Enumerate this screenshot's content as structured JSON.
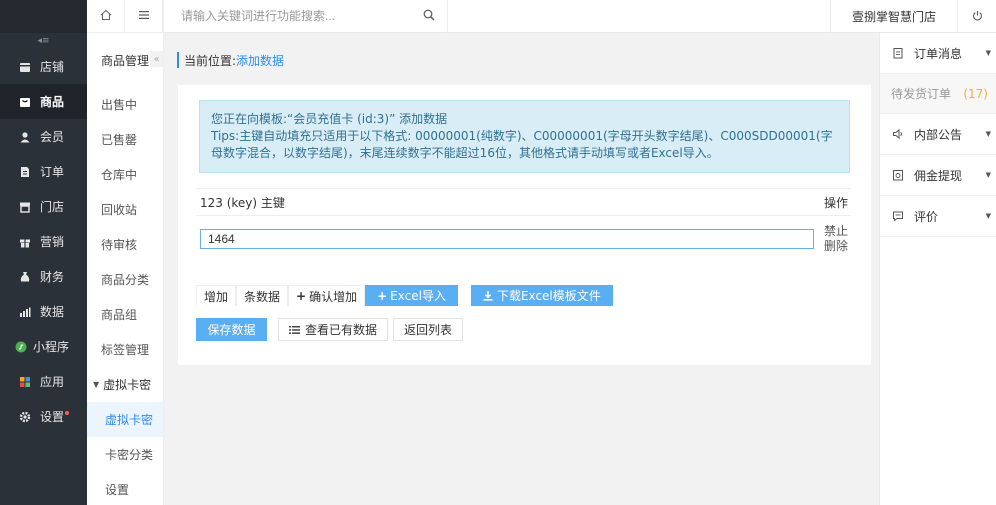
{
  "sidebar": {
    "collapse_glyph": "◂≡",
    "items": [
      {
        "label": "店铺",
        "icon": "store-icon"
      },
      {
        "label": "商品",
        "icon": "goods-icon",
        "active": true
      },
      {
        "label": "会员",
        "icon": "user-icon"
      },
      {
        "label": "订单",
        "icon": "order-icon"
      },
      {
        "label": "门店",
        "icon": "shop-icon"
      },
      {
        "label": "营销",
        "icon": "gift-icon"
      },
      {
        "label": "财务",
        "icon": "money-bag-icon"
      },
      {
        "label": "数据",
        "icon": "chart-icon"
      },
      {
        "label": "小程序",
        "icon": "miniapp-icon"
      },
      {
        "label": "应用",
        "icon": "apps-icon"
      },
      {
        "label": "设置",
        "icon": "gear-icon",
        "badge": true
      }
    ]
  },
  "subnav": {
    "title": "商品管理",
    "items": [
      "出售中",
      "已售罄",
      "仓库中",
      "回收站",
      "待审核",
      "商品分类",
      "商品组",
      "标签管理"
    ],
    "group": "虚拟卡密",
    "children": [
      "虚拟卡密",
      "卡密分类",
      "设置"
    ],
    "active_child": "虚拟卡密"
  },
  "topbar": {
    "search_placeholder": "请输入关键词进行功能搜索...",
    "store_name": "壹捌掌智慧门店"
  },
  "breadcrumb": {
    "label": "当前位置:",
    "current": "添加数据"
  },
  "alert": {
    "line1": "您正在向模板:“会员充值卡 (id:3)” 添加数据",
    "line2": "Tips:主键自动填充只适用于以下格式: 00000001(纯数字)、C00000001(字母开头数字结尾)、C000SDD00001(字母数字混合，以数字结尾)，末尾连续数字不能超过16位，其他格式请手动填写或者Excel导入。"
  },
  "table": {
    "col_key": "123 (key) 主键",
    "col_ops": "操作",
    "row_value": "1464",
    "op_disable": "禁止",
    "op_delete": "删除"
  },
  "actions": {
    "add": "增加",
    "count_suffix": "条数据",
    "confirm_add": "确认增加",
    "excel_import": "Excel导入",
    "download_template": "下载Excel模板文件",
    "save": "保存数据",
    "view_existing": "查看已有数据",
    "back_list": "返回列表"
  },
  "right_panel": {
    "order_msg": "订单消息",
    "pending_label": "待发货订单",
    "pending_count": "(17)",
    "notice": "内部公告",
    "commission": "佣金提现",
    "review": "评价"
  }
}
